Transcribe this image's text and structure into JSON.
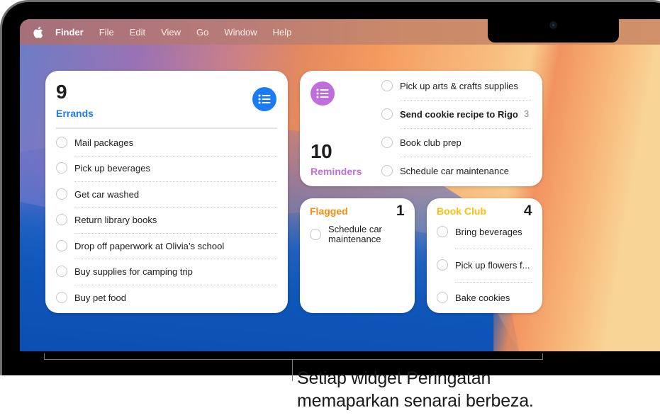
{
  "menubar": {
    "apple_icon": "apple-logo",
    "items": [
      "Finder",
      "File",
      "Edit",
      "View",
      "Go",
      "Window",
      "Help"
    ]
  },
  "widgets": {
    "errands": {
      "count": "9",
      "title": "Errands",
      "color": "#1a7cf5",
      "icon": "list-icon",
      "items": [
        "Mail packages",
        "Pick up beverages",
        "Get car washed",
        "Return library books",
        "Drop off paperwork at Olivia’s school",
        "Buy supplies for camping trip",
        "Buy pet food"
      ]
    },
    "reminders": {
      "count": "10",
      "title": "Reminders",
      "color": "#bf6fdc",
      "icon": "list-icon",
      "items": [
        {
          "text": "Pick up arts & crafts supplies",
          "bold": false,
          "badge": ""
        },
        {
          "text": "Send cookie recipe to Rigo",
          "bold": true,
          "badge": "3"
        },
        {
          "text": "Book club prep",
          "bold": false,
          "badge": ""
        },
        {
          "text": "Schedule car maintenance",
          "bold": false,
          "badge": ""
        }
      ]
    },
    "flagged": {
      "count": "1",
      "title": "Flagged",
      "color": "#f7900d",
      "items": [
        "Schedule car maintenance"
      ]
    },
    "bookclub": {
      "count": "4",
      "title": "Book Club",
      "color": "#f9c10d",
      "items": [
        "Bring beverages",
        "Pick up flowers f...",
        "Bake cookies"
      ]
    }
  },
  "callout": {
    "line1": "Setiap widget Peringatan",
    "line2": "memaparkan senarai berbeza."
  }
}
